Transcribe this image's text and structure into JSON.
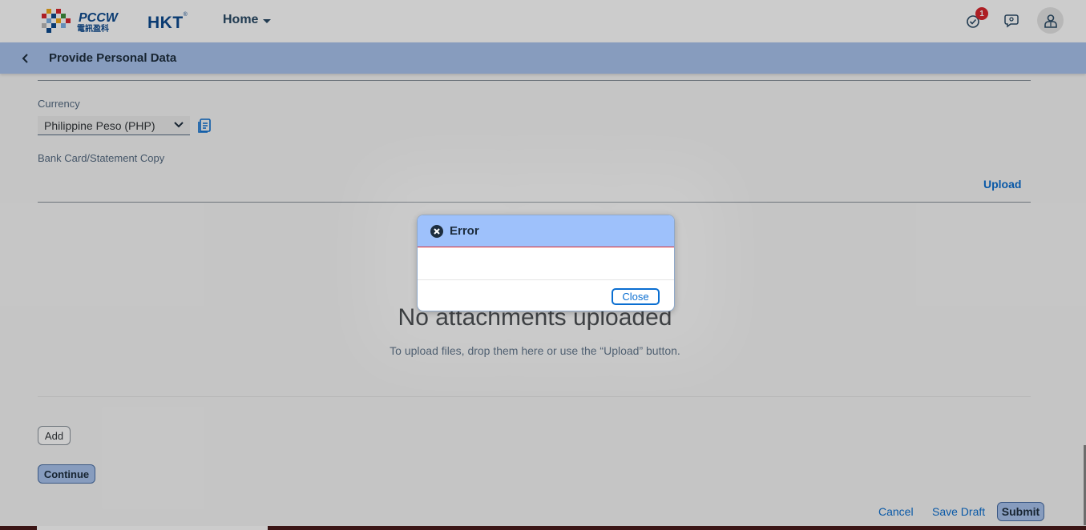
{
  "header": {
    "brand_primary": "PCCW",
    "brand_chinese": "電訊盈科",
    "brand_secondary": "HKT",
    "nav_label": "Home",
    "notifications_count": "1",
    "icons": [
      "notifications-icon",
      "chat-icon",
      "user-avatar-icon"
    ]
  },
  "subheader": {
    "title": "Provide Personal Data"
  },
  "form": {
    "currency_label": "Currency",
    "currency_value": "Philippine Peso (PHP)",
    "bank_copy_label": "Bank Card/Statement Copy",
    "upload_label": "Upload",
    "no_attachments_title": "No attachments uploaded",
    "no_attachments_hint": "To upload files, drop them here or use the “Upload” button.",
    "add_label": "Add",
    "continue_label": "Continue"
  },
  "footer": {
    "cancel_label": "Cancel",
    "save_draft_label": "Save Draft",
    "submit_label": "Submit"
  },
  "dialog": {
    "title": "Error",
    "message": "",
    "close_label": "Close"
  },
  "colors": {
    "subheader_bg": "#a9c4ee",
    "dialog_header_bg": "#9ec1fb",
    "link": "#0a6ed1",
    "error": "#d9262d"
  }
}
